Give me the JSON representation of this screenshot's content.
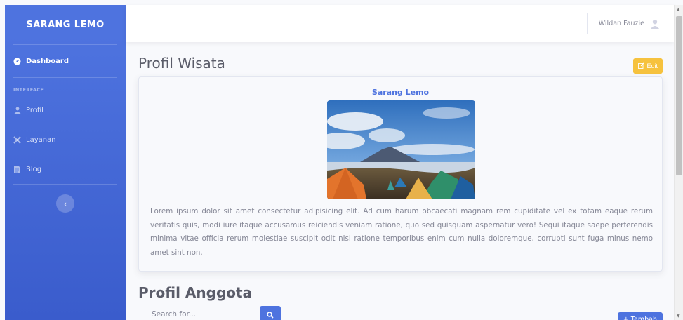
{
  "sidebar": {
    "brand": "SARANG LEMO",
    "dashboard_label": "Dashboard",
    "heading": "INTERFACE",
    "items": [
      {
        "label": "Profil",
        "icon": "user-icon"
      },
      {
        "label": "Layanan",
        "icon": "tools-icon"
      },
      {
        "label": "Blog",
        "icon": "file-icon"
      }
    ],
    "toggle_glyph": "‹"
  },
  "topbar": {
    "user_name": "Wildan Fauzie"
  },
  "profil_wisata": {
    "title": "Profil Wisata",
    "edit_label": "Edit",
    "card_title": "Sarang Lemo",
    "description": "Lorem ipsum dolor sit amet consectetur adipisicing elit. Ad cum harum obcaecati magnam rem cupiditate vel ex totam eaque rerum veritatis quis, modi iure itaque accusamus reiciendis veniam ratione, quo sed quisquam aspernatur vero! Sequi itaque saepe perferendis minima vitae officia rerum molestiae suscipit odit nisi ratione temporibus enim cum nulla doloremque, corrupti sunt fuga minus nemo amet sint non."
  },
  "profil_anggota": {
    "title": "Profil Anggota",
    "search_placeholder": "Search for...",
    "add_label": "+ Tambah"
  },
  "colors": {
    "primary": "#4e73df",
    "warning": "#f6c23e",
    "text": "#858796",
    "heading": "#5a5c69"
  }
}
